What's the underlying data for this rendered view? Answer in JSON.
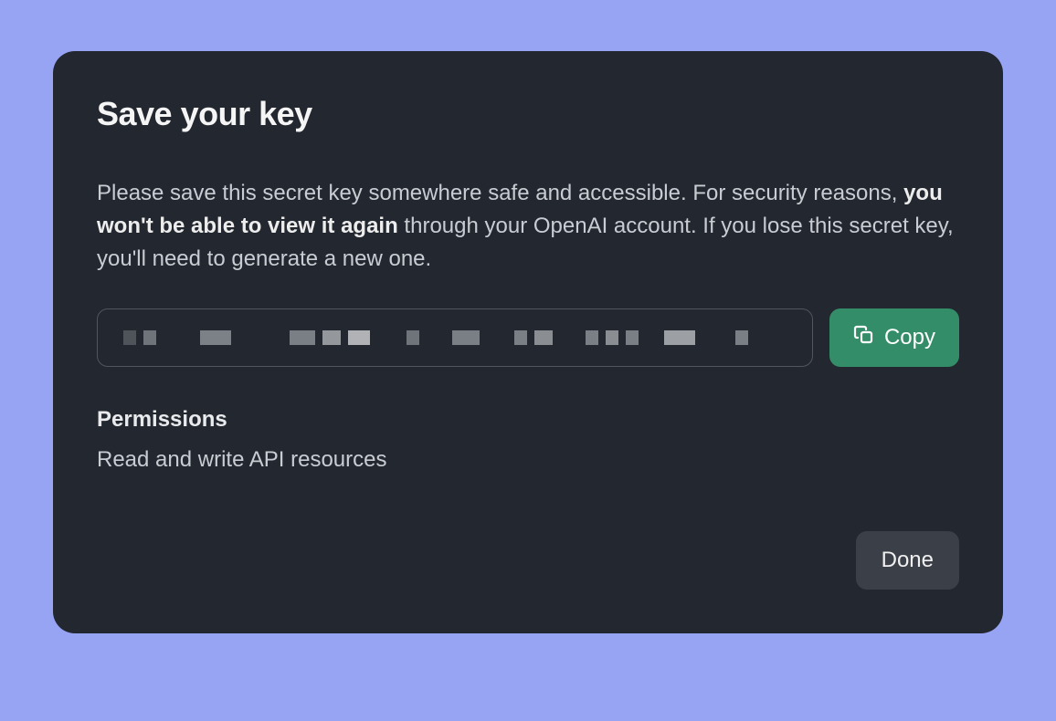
{
  "modal": {
    "title": "Save your key",
    "description_prefix": "Please save this secret key somewhere safe and accessible. For security reasons, ",
    "description_bold": "you won't be able to view it again",
    "description_suffix": " through your OpenAI account. If you lose this secret key, you'll need to generate a new one.",
    "key_value_obscured": true,
    "copy_label": "Copy",
    "permissions_label": "Permissions",
    "permissions_value": "Read and write API resources",
    "done_label": "Done"
  }
}
